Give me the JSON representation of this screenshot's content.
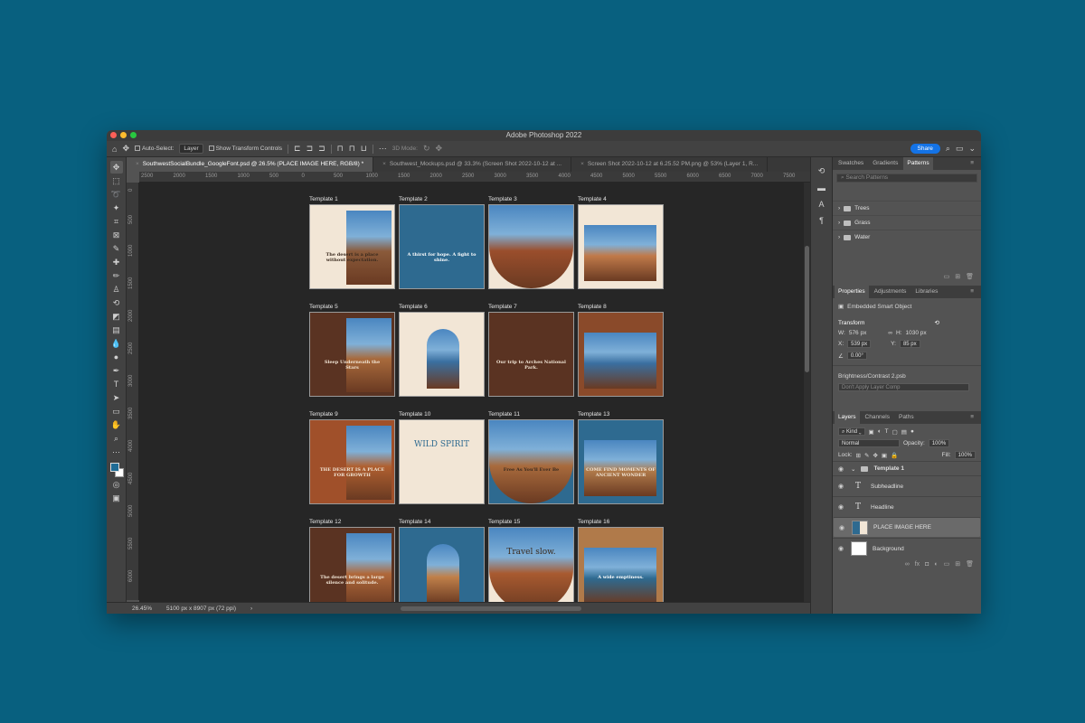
{
  "app": {
    "title": "Adobe Photoshop 2022"
  },
  "options": {
    "auto_select_label": "Auto-Select:",
    "layer_select": "Layer",
    "transform_label": "Show Transform Controls",
    "mode_3d": "3D Mode:",
    "share_label": "Share"
  },
  "doc_tabs": [
    {
      "label": "SouthwestSocialBundle_GoogleFont.psd @ 26.5% (PLACE IMAGE HERE, RGB/8) *"
    },
    {
      "label": "Southwest_Mockups.psd @ 33.3% (Screen Shot 2022-10-12 at ..."
    },
    {
      "label": "Screen Shot 2022-10-12 at 6.25.52 PM.png @ 53% (Layer 1, R..."
    }
  ],
  "ruler_h": [
    "2500",
    "2000",
    "1500",
    "1000",
    "500",
    "0",
    "500",
    "1000",
    "1500",
    "2000",
    "2500",
    "3000",
    "3500",
    "4000",
    "4500",
    "5000",
    "5500",
    "6000",
    "6500",
    "7000",
    "7500"
  ],
  "ruler_v": [
    "0",
    "500",
    "1000",
    "1500",
    "2000",
    "2500",
    "3000",
    "3500",
    "4000",
    "4500",
    "5000",
    "5500",
    "6000",
    "6500",
    "7000",
    "7500"
  ],
  "templates": [
    {
      "label": "Template 1",
      "bg": "#f2e6d6",
      "text": "The desert is a place without expectation.",
      "tc": "#3a2a1e",
      "img": "#8a5a3a"
    },
    {
      "label": "Template 2",
      "bg": "#2e6a90",
      "text": "A thirst for hope. A fight to shine.",
      "tc": "#ffffff",
      "img": ""
    },
    {
      "label": "Template 3",
      "bg": "#f2e6d6",
      "text": "",
      "tc": "",
      "img": "#9a4e2c"
    },
    {
      "label": "Template 4",
      "bg": "#f2e6d6",
      "text": "",
      "tc": "",
      "img": "#c07a4a"
    },
    {
      "label": "Template 5",
      "bg": "#5a3322",
      "text": "Sleep Underneath the Stars",
      "tc": "#f2e6d6",
      "img": "#a86a3c"
    },
    {
      "label": "Template 6",
      "bg": "#f2e6d6",
      "text": "",
      "tc": "",
      "img": "#3a6fa0"
    },
    {
      "label": "Template 7",
      "bg": "#5a3322",
      "text": "Our trip to Arches National Park.",
      "tc": "#f2e6d6",
      "img": ""
    },
    {
      "label": "Template 8",
      "bg": "#8a4a2a",
      "text": "",
      "tc": "",
      "img": "#3a6fa0"
    },
    {
      "label": "Template 9",
      "bg": "#a0502a",
      "text": "THE DESERT IS A PLACE FOR GROWTH",
      "tc": "#f2e6d6",
      "img": "#b06030"
    },
    {
      "label": "Template 10",
      "bg": "#f2e6d6",
      "text": "WILD SPIRIT",
      "tc": "#2e6a90",
      "img": ""
    },
    {
      "label": "Template 11",
      "bg": "#2e6a90",
      "text": "Free As You'll Ever Be",
      "tc": "#3a2a1e",
      "img": "#a86a3c"
    },
    {
      "label": "Template 13",
      "bg": "#2e6a90",
      "text": "COME FIND MOMENTS OF ANCIENT WONDER",
      "tc": "#f2e6d6",
      "img": "#b07a4a"
    },
    {
      "label": "Template 12",
      "bg": "#5a3322",
      "text": "The desert brings a large silence and solitude.",
      "tc": "#f2e6d6",
      "img": "#b0683a"
    },
    {
      "label": "Template 14",
      "bg": "#2e6a90",
      "text": "",
      "tc": "",
      "img": "#c0804a"
    },
    {
      "label": "Template 15",
      "bg": "#f2e6d6",
      "text": "Travel slow.",
      "tc": "#3a2a1e",
      "img": "#a85a30"
    },
    {
      "label": "Template 16",
      "bg": "#b07a4a",
      "text": "A wide emptiness.",
      "tc": "#ffffff",
      "img": "#2e6a90"
    }
  ],
  "status": {
    "zoom": "26.45%",
    "doc_size": "5100 px x 8907 px (72 ppi)"
  },
  "patterns_panel": {
    "tabs": [
      "Swatches",
      "Gradients",
      "Patterns"
    ],
    "search_placeholder": "Search Patterns",
    "folders": [
      "Trees",
      "Grass",
      "Water"
    ]
  },
  "properties_panel": {
    "tabs": [
      "Properties",
      "Adjustments",
      "Libraries"
    ],
    "object_type": "Embedded Smart Object",
    "transform_label": "Transform",
    "w": "576 px",
    "h": "1030 px",
    "x": "539 px",
    "y": "85 px",
    "angle": "0.00°",
    "linked_file": "Brightness/Contrast 2.psb",
    "layer_comp": "Don't Apply Layer Comp"
  },
  "layers_panel": {
    "tabs": [
      "Layers",
      "Channels",
      "Paths"
    ],
    "kind": "Kind",
    "blend": "Normal",
    "opacity_label": "Opacity:",
    "opacity": "100%",
    "lock_label": "Lock:",
    "fill_label": "Fill:",
    "fill": "100%",
    "group": "Template 1",
    "layers": [
      {
        "name": "Subheadline",
        "type": "text"
      },
      {
        "name": "Headline",
        "type": "text"
      },
      {
        "name": "PLACE IMAGE HERE",
        "type": "smart"
      },
      {
        "name": "Background",
        "type": "fill"
      }
    ]
  }
}
